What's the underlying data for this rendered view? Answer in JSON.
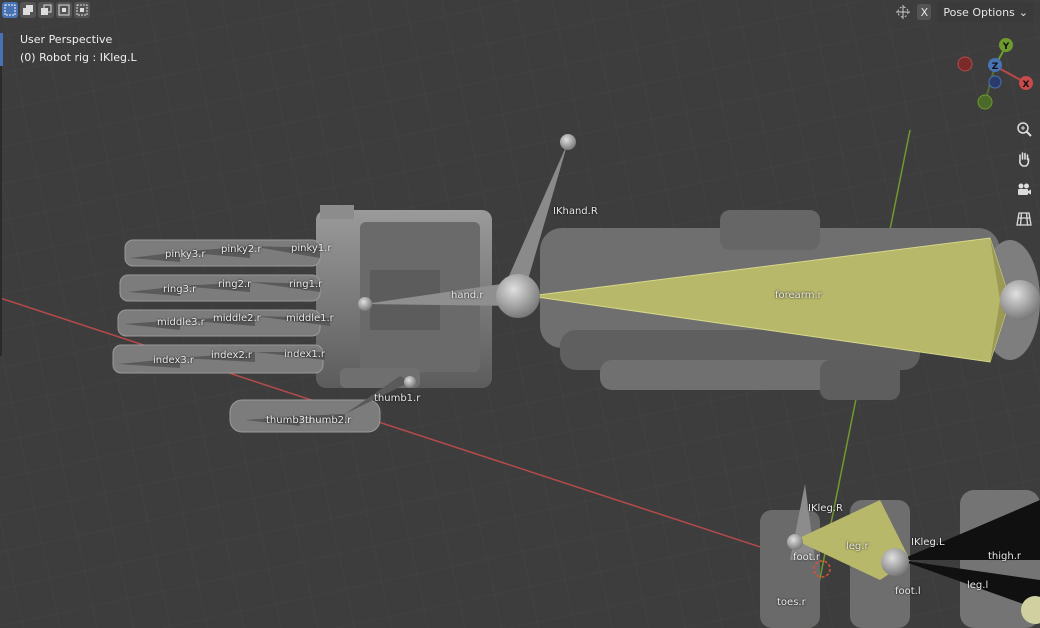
{
  "header": {
    "select_modes": [
      "select-new",
      "select-extend",
      "select-subtract",
      "select-invert",
      "select-intersect"
    ],
    "x_label": "X",
    "pose_options_label": "Pose Options"
  },
  "hud": {
    "title": "User Perspective",
    "subtitle": "(0) Robot rig : IKleg.L"
  },
  "gizmo": {
    "y": "Y",
    "z": "Z",
    "x": "X"
  },
  "bones": {
    "ikhand": "IKhand.R",
    "hand": "hand.r",
    "forearm": "forearm.r",
    "pinky3": "pinky3.r",
    "pinky2": "pinky2.r",
    "pinky1": "pinky1.r",
    "ring3": "ring3.r",
    "ring2": "ring2.r",
    "ring1": "ring1.r",
    "middle3": "middle3.r",
    "middle2": "middle2.r",
    "middle1": "middle1.r",
    "index3": "index3.r",
    "index2": "index2.r",
    "index1": "index1.r",
    "thumb1": "thumb1.r",
    "thumb2": "thumb2.r",
    "thumb3": "thumb3.r",
    "ikleg_r": "IKleg.R",
    "leg_r": "leg.r",
    "foot_r": "foot.r",
    "toes_r": "toes.r",
    "ikleg_l": "IKleg.L",
    "thigh_r": "thigh.r",
    "leg_l": "leg.l",
    "foot_l": "foot.l"
  },
  "colors": {
    "grid_bg": "#3d3d3d",
    "x_axis": "#b64a4a",
    "y_axis": "#6f9a2e",
    "selected_bone": "#b8b86a",
    "accent": "#4772b3"
  },
  "nav_icons": [
    "zoom-icon",
    "hand-pan-icon",
    "camera-icon",
    "grid-view-icon"
  ]
}
